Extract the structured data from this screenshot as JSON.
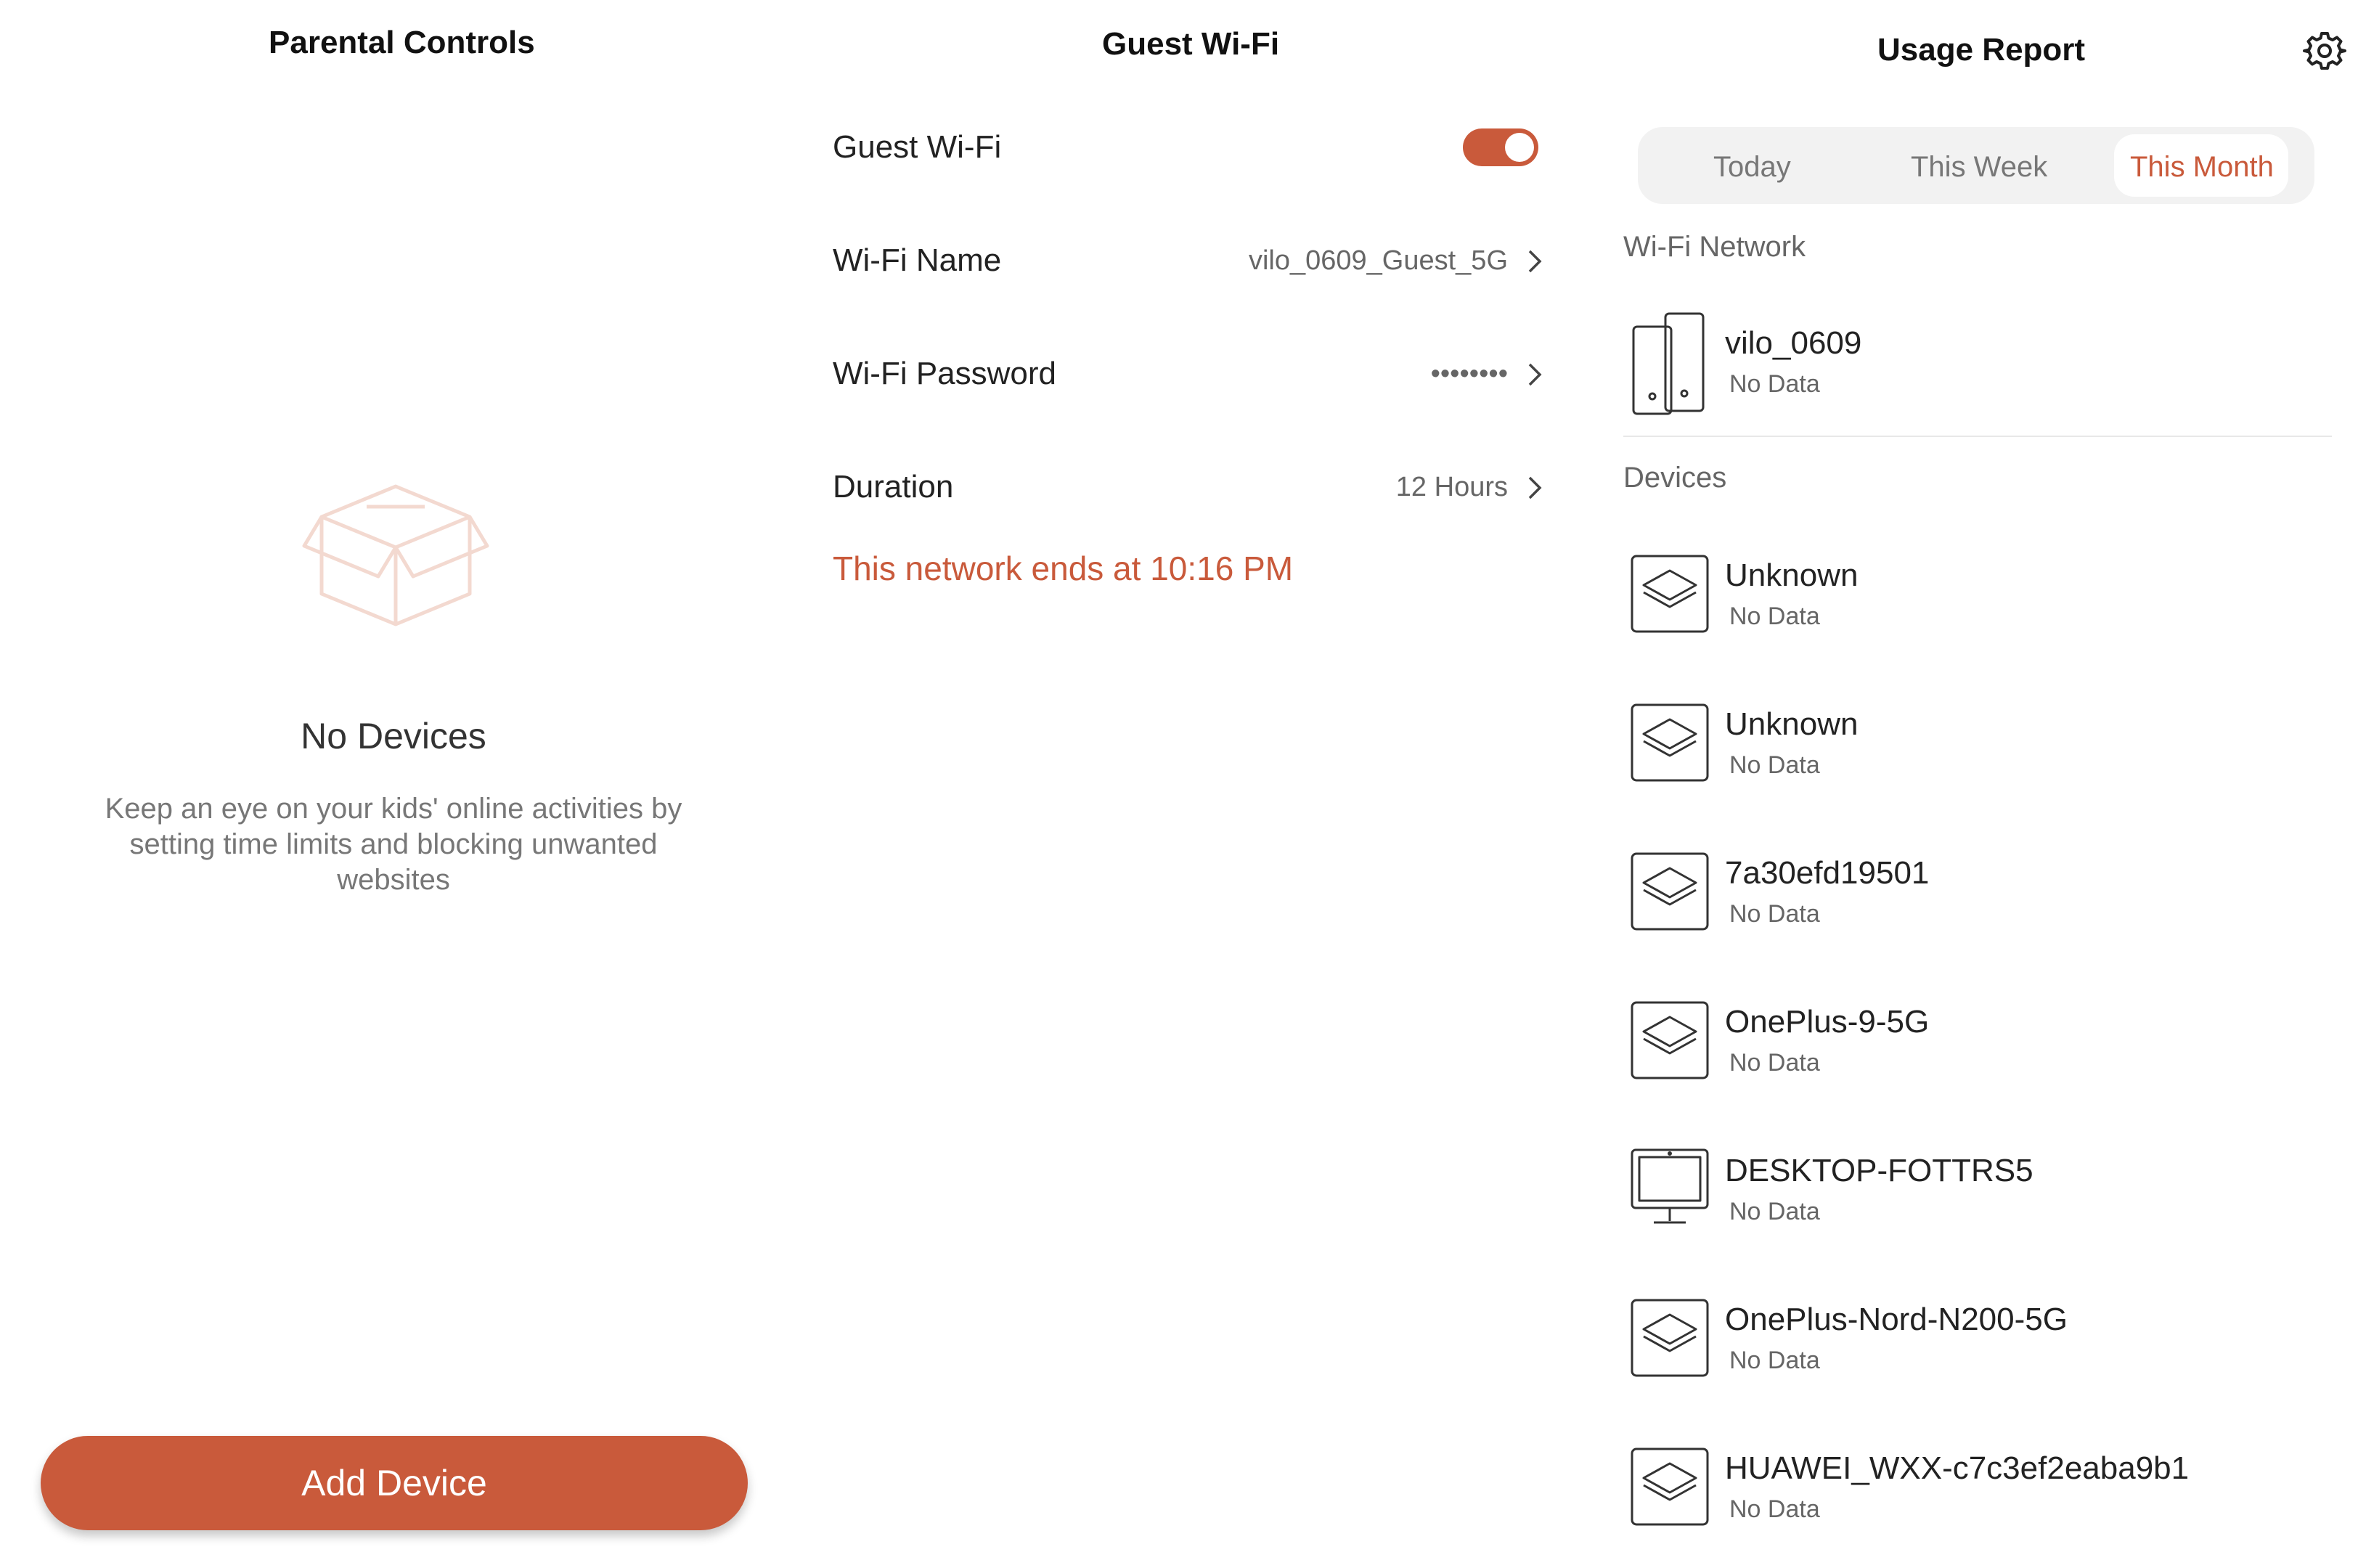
{
  "parental": {
    "title": "Parental Controls",
    "empty_title": "No Devices",
    "empty_desc": "Keep an eye on your kids' online activities by setting time limits and blocking unwanted websites",
    "add_button": "Add Device",
    "accent": "#c95a3b",
    "empty_icon": "open-box-icon"
  },
  "guest": {
    "title": "Guest Wi-Fi",
    "toggle_label": "Guest Wi-Fi",
    "toggle_on": true,
    "rows": [
      {
        "label": "Wi-Fi Name",
        "value": "vilo_0609_Guest_5G"
      },
      {
        "label": "Wi-Fi Password",
        "value": "••••••••"
      },
      {
        "label": "Duration",
        "value": "12 Hours"
      }
    ],
    "ends_note": "This network ends at 10:16  PM"
  },
  "usage": {
    "title": "Usage Report",
    "settings_icon": "gear-icon",
    "tabs": [
      {
        "label": "Today"
      },
      {
        "label": "This Week"
      },
      {
        "label": "This Month",
        "active": true
      }
    ],
    "network_section": "Wi-Fi Network",
    "network": {
      "name": "vilo_0609",
      "status": "No Data",
      "icon": "router-icon"
    },
    "devices_section": "Devices",
    "devices": [
      {
        "name": "Unknown",
        "status": "No Data",
        "icon": "layers-icon"
      },
      {
        "name": "Unknown",
        "status": "No Data",
        "icon": "layers-icon"
      },
      {
        "name": "7a30efd19501",
        "status": "No Data",
        "icon": "layers-icon"
      },
      {
        "name": "OnePlus-9-5G",
        "status": "No Data",
        "icon": "layers-icon"
      },
      {
        "name": "DESKTOP-FOTTRS5",
        "status": "No Data",
        "icon": "monitor-icon"
      },
      {
        "name": "OnePlus-Nord-N200-5G",
        "status": "No Data",
        "icon": "layers-icon"
      },
      {
        "name": "HUAWEI_WXX-c7c3ef2eaba9b1",
        "status": "No Data",
        "icon": "layers-icon"
      }
    ]
  }
}
